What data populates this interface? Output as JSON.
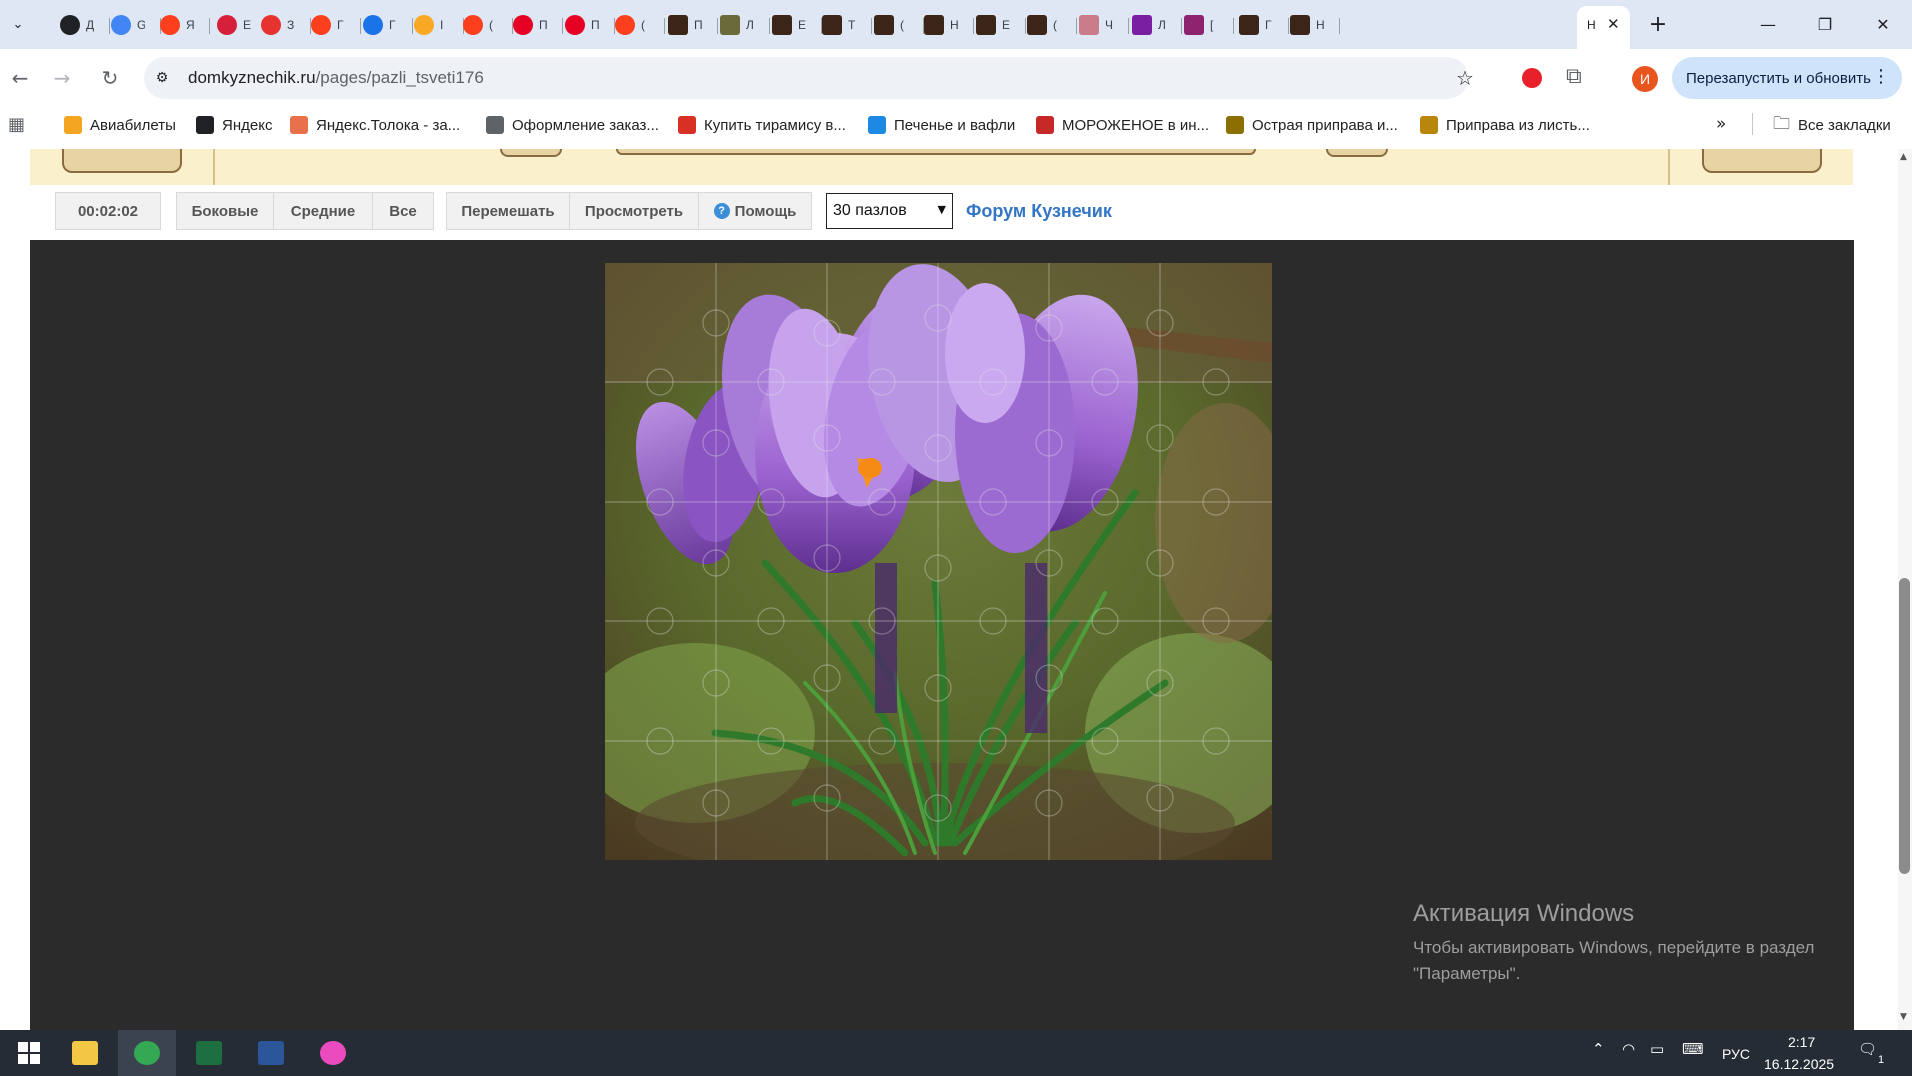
{
  "browser": {
    "tabs": [
      {
        "icon": "plus-icon",
        "color": "#202124",
        "label": "Д"
      },
      {
        "icon": "google-icon",
        "color": "#4285f4",
        "label": "G"
      },
      {
        "icon": "yandex-icon",
        "color": "#fc3f1d",
        "label": "Я"
      },
      {
        "icon": "star-icon",
        "color": "#d6203b",
        "label": "E"
      },
      {
        "icon": "chat-icon",
        "color": "#e8322f",
        "label": "З"
      },
      {
        "icon": "yandex-icon",
        "color": "#fc3f1d",
        "label": "Г"
      },
      {
        "icon": "sparkle-icon",
        "color": "#1a73e8",
        "label": "Г"
      },
      {
        "icon": "fire-icon",
        "color": "#f9a825",
        "label": "I"
      },
      {
        "icon": "yandex-icon",
        "color": "#fc3f1d",
        "label": "("
      },
      {
        "icon": "pinterest-icon",
        "color": "#e60023",
        "label": "П"
      },
      {
        "icon": "pinterest-icon",
        "color": "#e60023",
        "label": "П"
      },
      {
        "icon": "yandex-icon",
        "color": "#fc3f1d",
        "label": "("
      },
      {
        "icon": "puzzle-site-icon",
        "color": "#3b2418",
        "label": "П"
      },
      {
        "icon": "puzzle-site-icon",
        "color": "#6b6a3a",
        "label": "Л"
      },
      {
        "icon": "puzzle-site-icon",
        "color": "#3b2418",
        "label": "Е"
      },
      {
        "icon": "puzzle-site-icon",
        "color": "#3b2418",
        "label": "Т"
      },
      {
        "icon": "puzzle-site-icon",
        "color": "#3b2418",
        "label": "("
      },
      {
        "icon": "puzzle-site-icon",
        "color": "#3b2418",
        "label": "Н"
      },
      {
        "icon": "puzzle-site-icon",
        "color": "#3b2418",
        "label": "Е"
      },
      {
        "icon": "puzzle-site-icon",
        "color": "#3b2418",
        "label": "("
      },
      {
        "icon": "image-icon",
        "color": "#c97c8a",
        "label": "Ч"
      },
      {
        "icon": "image-icon",
        "color": "#7b1fa2",
        "label": "Л"
      },
      {
        "icon": "image-icon",
        "color": "#8e2470",
        "label": "["
      },
      {
        "icon": "puzzle-site-icon",
        "color": "#3b2418",
        "label": "Г"
      },
      {
        "icon": "puzzle-site-icon",
        "color": "#3b2418",
        "label": "Н"
      }
    ],
    "active_tab_label": "Н",
    "url_host": "domkyznechik.ru",
    "url_path": "/pages/pazli_tsveti176",
    "profile_initial": "И",
    "relaunch_label": "Перезапустить и обновить",
    "bookmarks": [
      {
        "label": "Авиабилеты",
        "color": "#f4a623"
      },
      {
        "label": "Яндекс",
        "color": "#202124"
      },
      {
        "label": "Яндекс.Толока - за...",
        "color": "#e8704a"
      },
      {
        "label": "Оформление заказ...",
        "color": "#5f6368"
      },
      {
        "label": "Купить тирамису в...",
        "color": "#d93025"
      },
      {
        "label": "Печенье и вафли",
        "color": "#1e88e5"
      },
      {
        "label": "МОРОЖЕНОЕ в ин...",
        "color": "#c62828"
      },
      {
        "label": "Острая приправа и...",
        "color": "#8d6e00"
      },
      {
        "label": "Приправа из листь...",
        "color": "#b8860b"
      }
    ],
    "all_bookmarks_label": "Все закладки"
  },
  "page": {
    "timer": "00:02:02",
    "edge_buttons": [
      "Боковые",
      "Средние",
      "Все"
    ],
    "action_buttons": [
      "Перемешать",
      "Просмотреть",
      "Помощь"
    ],
    "pieces_select": "30 пазлов",
    "forum_link": "Форум Кузнечик",
    "activation_title": "Активация Windows",
    "activation_line1": "Чтобы активировать Windows, перейдите в раздел",
    "activation_line2": "\"Параметры\"."
  },
  "taskbar": {
    "apps": [
      {
        "name": "file-explorer-icon",
        "color": "#f2c744"
      },
      {
        "name": "chrome-icon",
        "color": "#34a853"
      },
      {
        "name": "excel-icon",
        "color": "#1d6f42"
      },
      {
        "name": "word-icon",
        "color": "#2b579a"
      },
      {
        "name": "itunes-icon",
        "color": "#ea4cc0"
      }
    ],
    "language": "РУС",
    "time": "2:17",
    "date": "16.12.2025",
    "notification_count": "1"
  }
}
